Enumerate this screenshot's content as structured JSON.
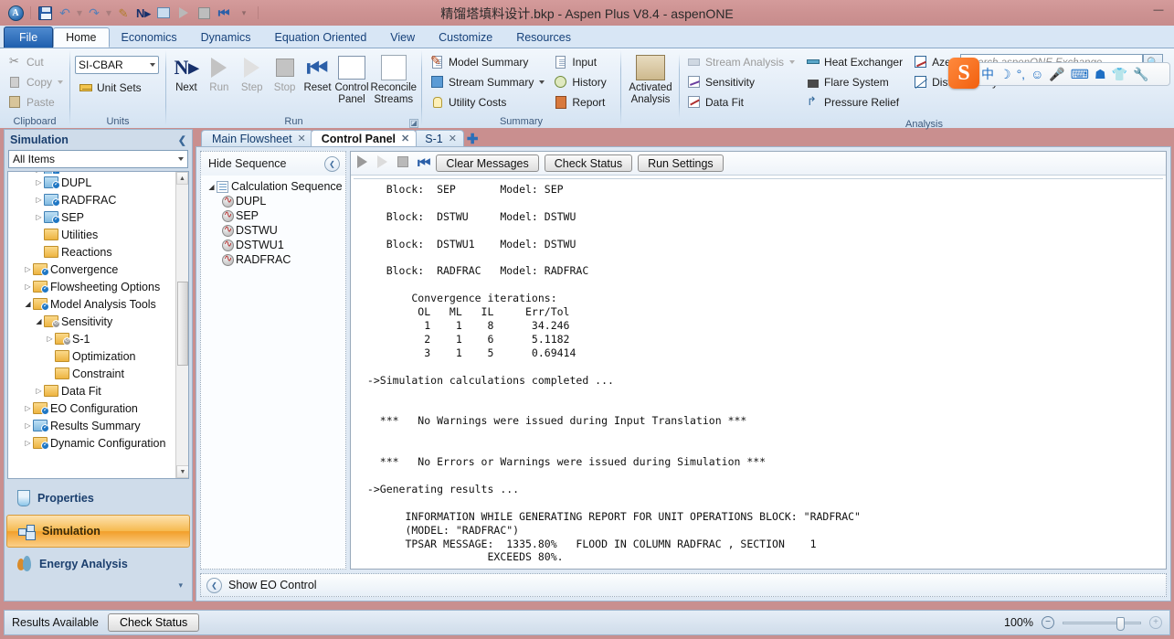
{
  "window": {
    "title": "精馏塔填料设计.bkp - Aspen Plus V8.4 - aspenONE",
    "minimize": "—",
    "maximize": "❐",
    "close": "✕"
  },
  "quick_access": [
    {
      "name": "aspen-logo-icon",
      "label": "A"
    },
    {
      "name": "save-icon",
      "label": ""
    },
    {
      "name": "undo-icon",
      "label": "↶"
    },
    {
      "name": "redo-icon",
      "label": "↷"
    },
    {
      "name": "next-input-icon",
      "label": ""
    },
    {
      "name": "next-icon",
      "label": "N"
    },
    {
      "name": "control-panel-icon",
      "label": ""
    },
    {
      "name": "run-icon",
      "label": ""
    },
    {
      "name": "stop-icon",
      "label": ""
    },
    {
      "name": "reset-icon",
      "label": "⏮"
    },
    {
      "name": "customize-qat-icon",
      "label": "▾"
    }
  ],
  "ribbon": {
    "tabs": [
      {
        "label": "File",
        "active": false,
        "kind": "file"
      },
      {
        "label": "Home",
        "active": true,
        "kind": "normal"
      },
      {
        "label": "Economics",
        "active": false,
        "kind": "normal"
      },
      {
        "label": "Dynamics",
        "active": false,
        "kind": "normal"
      },
      {
        "label": "Equation Oriented",
        "active": false,
        "kind": "normal"
      },
      {
        "label": "View",
        "active": false,
        "kind": "normal"
      },
      {
        "label": "Customize",
        "active": false,
        "kind": "normal"
      },
      {
        "label": "Resources",
        "active": false,
        "kind": "normal"
      }
    ],
    "groups": {
      "clipboard": {
        "label": "Clipboard",
        "items": [
          {
            "label": "Cut",
            "icon": "scissors-icon",
            "disabled": true
          },
          {
            "label": "Copy",
            "icon": "copy-icon",
            "disabled": true,
            "has_menu": true
          },
          {
            "label": "Paste",
            "icon": "paste-icon",
            "disabled": true
          }
        ]
      },
      "units": {
        "label": "Units",
        "unit_set_value": "SI-CBAR",
        "unit_sets_label": "Unit Sets"
      },
      "run": {
        "label": "Run",
        "buttons": [
          {
            "label": "Next",
            "icon": "next-icon",
            "disabled": false
          },
          {
            "label": "Run",
            "icon": "run-icon",
            "disabled": true
          },
          {
            "label": "Step",
            "icon": "step-icon",
            "disabled": true
          },
          {
            "label": "Stop",
            "icon": "stop-icon",
            "disabled": true
          },
          {
            "label": "Reset",
            "icon": "reset-icon",
            "disabled": false
          },
          {
            "label": "Control\nPanel",
            "icon": "control-panel-icon",
            "disabled": false
          },
          {
            "label": "Reconcile\nStreams",
            "icon": "reconcile-streams-icon",
            "disabled": false
          }
        ],
        "control_panel_line1": "Control",
        "control_panel_line2": "Panel",
        "reconcile_line1": "Reconcile",
        "reconcile_line2": "Streams"
      },
      "summary": {
        "label": "Summary",
        "col1": [
          {
            "label": "Model Summary",
            "icon": "model-summary-icon"
          },
          {
            "label": "Stream Summary",
            "icon": "stream-summary-icon",
            "has_menu": true
          },
          {
            "label": "Utility Costs",
            "icon": "utility-costs-icon"
          }
        ],
        "col2": [
          {
            "label": "Input",
            "icon": "input-icon"
          },
          {
            "label": "History",
            "icon": "history-icon"
          },
          {
            "label": "Report",
            "icon": "report-icon"
          }
        ]
      },
      "analysis": {
        "label": "Analysis",
        "activated_line1": "Activated",
        "activated_line2": "Analysis",
        "col1": [
          {
            "label": "Stream Analysis",
            "icon": "stream-analysis-icon",
            "disabled": true,
            "has_menu": true
          },
          {
            "label": "Sensitivity",
            "icon": "sensitivity-icon",
            "disabled": false
          },
          {
            "label": "Data Fit",
            "icon": "data-fit-icon",
            "disabled": false
          }
        ],
        "col2": [
          {
            "label": "Heat Exchanger",
            "icon": "heat-exchanger-icon"
          },
          {
            "label": "Flare System",
            "icon": "flare-system-icon"
          },
          {
            "label": "Pressure Relief",
            "icon": "pressure-relief-icon"
          }
        ],
        "col3": [
          {
            "label": "Azeotrope Search",
            "icon": "azeotrope-search-icon"
          },
          {
            "label": "Distillation Synthesis",
            "icon": "distillation-synthesis-icon"
          }
        ]
      }
    }
  },
  "search": {
    "placeholder": "Search aspenONE Exchange",
    "button_icon": "search-icon"
  },
  "ime": {
    "logo": "S",
    "items": [
      {
        "name": "chinese-mode-icon",
        "glyph": "中"
      },
      {
        "name": "crescent-icon",
        "glyph": "☾"
      },
      {
        "name": "punctuation-icon",
        "glyph": "°,"
      },
      {
        "name": "emoji-icon",
        "glyph": "☺"
      },
      {
        "name": "voice-input-icon",
        "glyph": "Ἲ4"
      },
      {
        "name": "soft-keyboard-icon",
        "glyph": "⌨"
      },
      {
        "name": "user-icon",
        "glyph": "♟"
      },
      {
        "name": "skin-icon",
        "glyph": "T"
      },
      {
        "name": "toolbox-icon",
        "glyph": "⚒"
      }
    ]
  },
  "navigation": {
    "header": "Simulation",
    "collapse_icon": "chevron-left-icon",
    "filter_value": "All Items",
    "tree": [
      {
        "label": "",
        "indent": 2,
        "expander": "closed",
        "folder": "blue",
        "badge": "blue",
        "clipped": true
      },
      {
        "label": "DUPL",
        "indent": 2,
        "expander": "closed",
        "folder": "blue",
        "badge": "blue"
      },
      {
        "label": "RADFRAC",
        "indent": 2,
        "expander": "closed",
        "folder": "blue",
        "badge": "blue"
      },
      {
        "label": "SEP",
        "indent": 2,
        "expander": "closed",
        "folder": "blue",
        "badge": "blue"
      },
      {
        "label": "Utilities",
        "indent": 2,
        "expander": "none",
        "folder": "yellow",
        "badge": "none"
      },
      {
        "label": "Reactions",
        "indent": 2,
        "expander": "none",
        "folder": "yellow",
        "badge": "none"
      },
      {
        "label": "Convergence",
        "indent": 1,
        "expander": "closed",
        "folder": "yellow",
        "badge": "blue"
      },
      {
        "label": "Flowsheeting Options",
        "indent": 1,
        "expander": "closed",
        "folder": "yellow",
        "badge": "blue"
      },
      {
        "label": "Model Analysis Tools",
        "indent": 1,
        "expander": "open",
        "folder": "yellow",
        "badge": "blue"
      },
      {
        "label": "Sensitivity",
        "indent": 2,
        "expander": "open",
        "folder": "yellow",
        "badge": "grey"
      },
      {
        "label": "S-1",
        "indent": 3,
        "expander": "closed",
        "folder": "yellow",
        "badge": "grey"
      },
      {
        "label": "Optimization",
        "indent": 3,
        "expander": "none",
        "folder": "yellow",
        "badge": "none"
      },
      {
        "label": "Constraint",
        "indent": 3,
        "expander": "none",
        "folder": "yellow",
        "badge": "none"
      },
      {
        "label": "Data Fit",
        "indent": 2,
        "expander": "closed",
        "folder": "yellow",
        "badge": "none"
      },
      {
        "label": "EO Configuration",
        "indent": 1,
        "expander": "closed",
        "folder": "yellow",
        "badge": "blue"
      },
      {
        "label": "Results Summary",
        "indent": 1,
        "expander": "closed",
        "folder": "blue",
        "badge": "blue"
      },
      {
        "label": "Dynamic Configuration",
        "indent": 1,
        "expander": "closed",
        "folder": "yellow",
        "badge": "blue"
      }
    ],
    "modes": [
      {
        "label": "Properties",
        "icon": "flask-icon",
        "selected": false
      },
      {
        "label": "Simulation",
        "icon": "flowsheet-icon",
        "selected": true
      },
      {
        "label": "Energy Analysis",
        "icon": "energy-icon",
        "selected": false
      }
    ]
  },
  "content_tabs": [
    {
      "label": "Main Flowsheet",
      "active": false,
      "close_icon": "close-icon"
    },
    {
      "label": "Control Panel",
      "active": true,
      "close_icon": "close-icon"
    },
    {
      "label": "S-1",
      "active": false,
      "close_icon": "close-icon"
    }
  ],
  "new_tab_icon": "plus-icon",
  "sequence_panel": {
    "title": "Hide Sequence",
    "collapse_icon": "chevron-left-icon",
    "root": "Calculation Sequence",
    "blocks": [
      "DUPL",
      "SEP",
      "DSTWU",
      "DSTWU1",
      "RADFRAC"
    ]
  },
  "control_panel": {
    "toolbar_icons": [
      {
        "name": "run-icon",
        "enabled": true
      },
      {
        "name": "step-icon",
        "enabled": false
      },
      {
        "name": "stop-icon",
        "enabled": false
      },
      {
        "name": "reinitialize-icon",
        "enabled": true
      }
    ],
    "buttons": [
      "Clear Messages",
      "Check Status",
      "Run Settings"
    ],
    "console_text": "    Block:  SEP       Model: SEP\n\n    Block:  DSTWU     Model: DSTWU\n\n    Block:  DSTWU1    Model: DSTWU\n\n    Block:  RADFRAC   Model: RADFRAC\n\n        Convergence iterations:\n         OL   ML   IL     Err/Tol\n          1    1    8      34.246\n          2    1    6      5.1182\n          3    1    5      0.69414\n\n ->Simulation calculations completed ...\n\n\n   ***   No Warnings were issued during Input Translation ***\n\n\n   ***   No Errors or Warnings were issued during Simulation ***\n\n ->Generating results ...\n\n       INFORMATION WHILE GENERATING REPORT FOR UNIT OPERATIONS BLOCK: \"RADFRAC\"\n       (MODEL: \"RADFRAC\")\n       TPSAR MESSAGE:  1335.80%   FLOOD IN COLUMN RADFRAC , SECTION    1\n                    EXCEEDS 80%.",
    "eo_control_label": "Show EO Control",
    "eo_control_icon": "chevron-up-icon"
  },
  "status_bar": {
    "status_text": "Results Available",
    "check_status_label": "Check Status",
    "zoom_label": "100%",
    "zoom_out_icon": "minus-circle-icon",
    "zoom_in_icon": "plus-circle-icon"
  }
}
